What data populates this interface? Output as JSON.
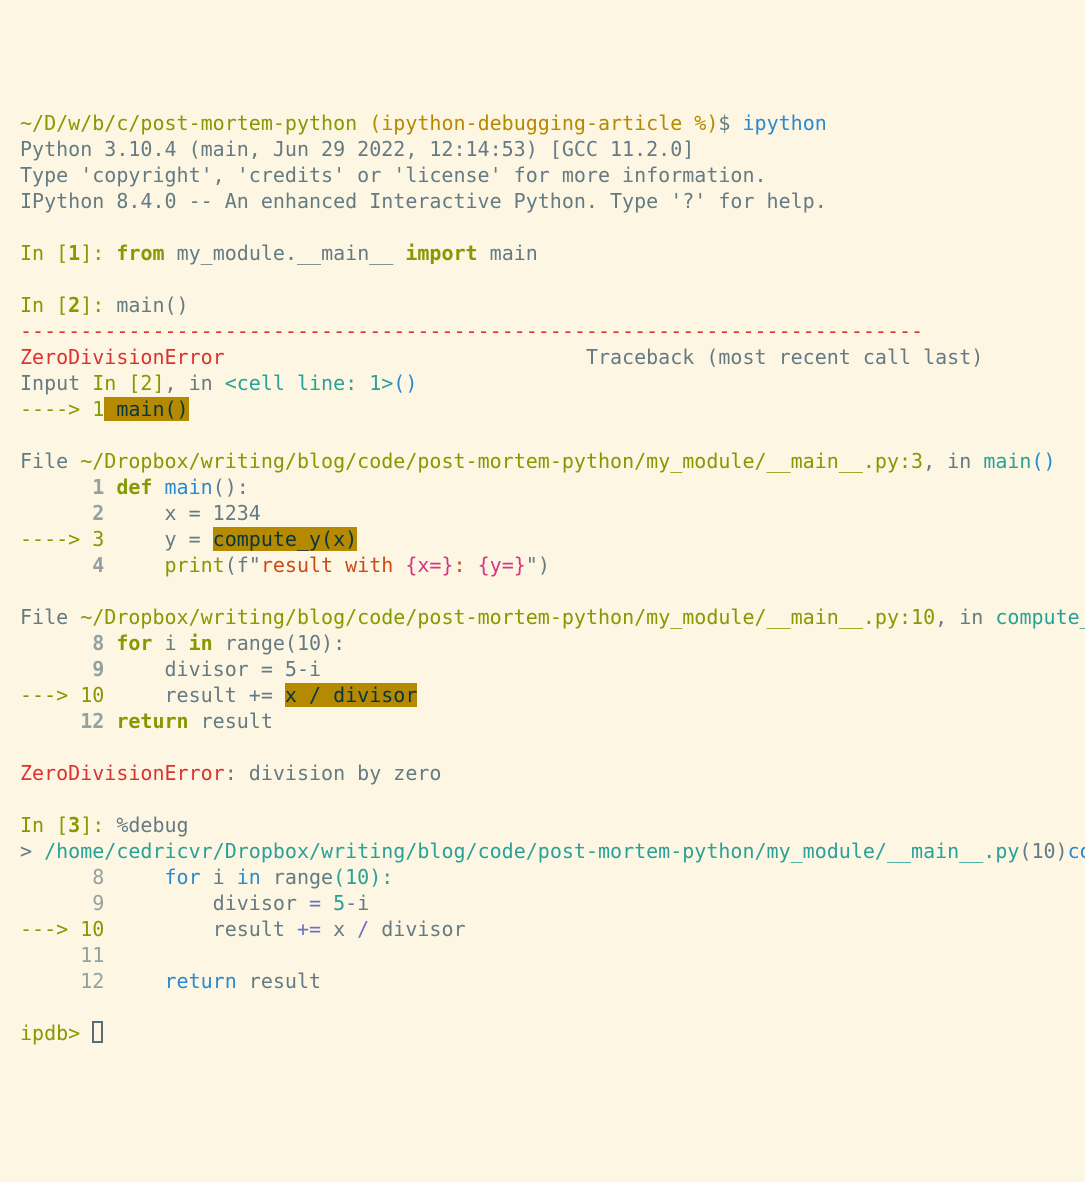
{
  "prompt": {
    "cwd": "~/D/w/b/c/post-mortem-python",
    "branch_status": "(ipython-debugging-article %)",
    "dollar": "$",
    "command": "ipython"
  },
  "banner": {
    "line1": "Python 3.10.4 (main, Jun 29 2022, 12:14:53) [GCC 11.2.0]",
    "line2": "Type 'copyright', 'credits' or 'license' for more information.",
    "line3": "IPython 8.4.0 -- An enhanced Interactive Python. Type '?' for help."
  },
  "in1": {
    "prefix": "In [",
    "num": "1",
    "suffix": "]:",
    "kw_from": "from",
    "pkg": " my_module.",
    "mainmod": "__main__",
    "kw_import": " import",
    "name": " main"
  },
  "in2": {
    "prefix": "In [",
    "num": "2",
    "suffix": "]:",
    "call": " main()"
  },
  "tb": {
    "dashes": "---------------------------------------------------------------------------",
    "err": "ZeroDivisionError",
    "pad1": "                              ",
    "tail": "Traceback (most recent call last)",
    "input": "Input ",
    "in_label": "In [2]",
    "comma_in": ", in ",
    "cell": "<cell line: 1>",
    "parens": "()",
    "arrow": "----> 1",
    "main_call": " main()",
    "file1_label": "File ",
    "file1_path": "~/Dropbox/writing/blog/code/post-mortem-python/my_module/__main__.py:3",
    "file1_in": ", in ",
    "file1_func": "main",
    "file1_parens": "()",
    "src1_ln1": "      1",
    "src1_def": " def",
    "src1_main": " main",
    "src1_sig": "():",
    "src1_ln2": "      2",
    "src1_body2": "     x = 1234",
    "src1_arrow": "----> 3",
    "src1_yeq": "     y = ",
    "src1_compute": "compute_y(x)",
    "src1_ln4": "      4",
    "src1_print": "     print",
    "src1_open": "(f\"",
    "src1_str1": "result with ",
    "src1_int1": "{x=}",
    "src1_colon": ": ",
    "src1_int2": "{y=}",
    "src1_close": "\")",
    "file2_label": "File ",
    "file2_path": "~/Dropbox/writing/blog/code/post-mortem-python/my_module/__main__.py:10",
    "file2_in": ", in ",
    "file2_func": "compute_",
    "src2_ln8": "      8",
    "src2_for": " for",
    "src2_i": " i ",
    "src2_in": "in",
    "src2_range": " range(10):",
    "src2_ln9": "      9",
    "src2_body9": "     divisor = 5-i",
    "src2_arrow": "---> 10",
    "src2_res": "     result += ",
    "src2_expr": "x / divisor",
    "src2_ln12": "     12",
    "src2_return": " return",
    "src2_result": " result",
    "final_err": "ZeroDivisionError",
    "final_msg": ": division by zero"
  },
  "in3": {
    "prefix": "In [",
    "num": "3",
    "suffix": "]:",
    "cmd": " %debug"
  },
  "pdb": {
    "angle": "> ",
    "path": "/home/cedricvr/Dropbox/writing/blog/code/post-mortem-python/my_module/__main__.py",
    "loc": "(10)",
    "func": "co",
    "ln8": "      8",
    "kw_for": "     for",
    "i": " i ",
    "kw_in": "in",
    "range": " range",
    "range_arg": "(10):",
    "ln9": "      9",
    "body9a": "         divisor ",
    "eq": "=",
    "body9b": " 5",
    "minus": "-",
    "body9c": "i",
    "arrow": "---> 10",
    "body10a": "         result ",
    "pluseq": "+=",
    "body10b": " x ",
    "div": "/",
    "body10c": " divisor",
    "ln11": "     11",
    "ln12": "     12",
    "ret": "     return",
    "retv": " result",
    "prompt": "ipdb> "
  }
}
